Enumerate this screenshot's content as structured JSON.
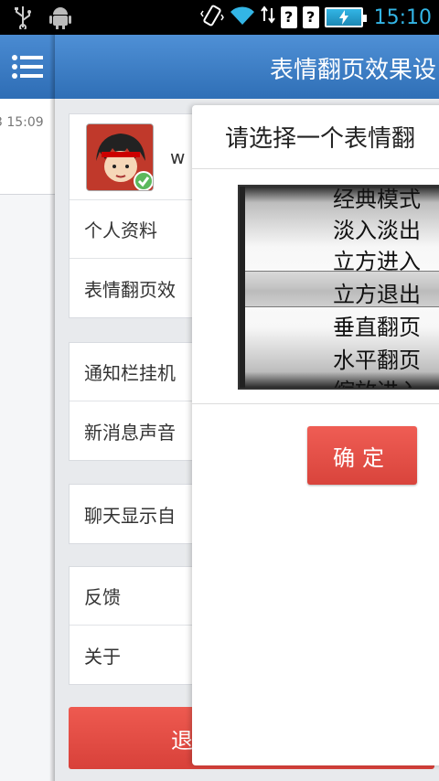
{
  "status_bar": {
    "time": "15:10",
    "icons": [
      "usb-icon",
      "android-icon",
      "vibrate-icon",
      "wifi-icon",
      "data-arrows-icon",
      "sim-unknown-icon",
      "sim-unknown-icon",
      "battery-charging-icon"
    ],
    "q1": "?",
    "q2": "?"
  },
  "left_panel": {
    "menu_icon": "menu-list-icon",
    "item_time": "3 15:09"
  },
  "topbar": {
    "title": "表情翻页效果设"
  },
  "settings": {
    "profile_name": "w",
    "profile_section": [
      "个人资料",
      "表情翻页效"
    ],
    "notify_section": [
      "通知栏挂机",
      "新消息声音"
    ],
    "chat_section": [
      "聊天显示自"
    ],
    "about_section": [
      "反馈",
      "关于"
    ],
    "logout_label": "退"
  },
  "dialog": {
    "title": "请选择一个表情翻",
    "picker_items": [
      "经典模式",
      "淡入淡出",
      "立方进入",
      "立方退出",
      "垂直翻页",
      "水平翻页",
      "缩放进入"
    ],
    "selected_item": "立方退出",
    "confirm_label": "确定"
  },
  "colors": {
    "header_blue": "#2f6fb6",
    "accent_red": "#d9443c",
    "status_time": "#33b5e5"
  }
}
